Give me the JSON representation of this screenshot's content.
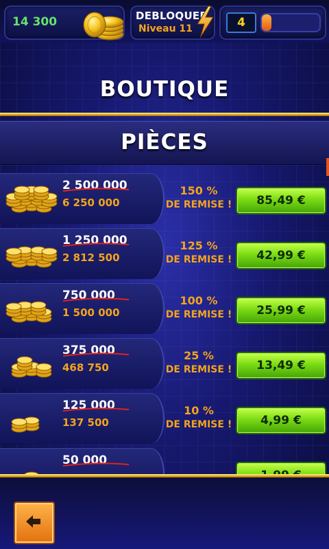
{
  "header": {
    "coins": "14 300",
    "unlock_title": "DEBLOQUER",
    "unlock_level": "Niveau 11",
    "player_level": "4",
    "xp_progress_percent": 17
  },
  "shop": {
    "title": "BOUTIQUE",
    "section": "PIÈCES"
  },
  "offers": [
    {
      "old": "2 500 000",
      "new": "6 250 000",
      "discount": "150 %",
      "discount_label": "DE REMISE !",
      "price": "85,49 €",
      "coins_icon": "coin-pile-huge"
    },
    {
      "old": "1 250 000",
      "new": "2 812 500",
      "discount": "125 %",
      "discount_label": "DE REMISE !",
      "price": "42,99 €",
      "coins_icon": "coin-pile-large"
    },
    {
      "old": "750 000",
      "new": "1 500 000",
      "discount": "100 %",
      "discount_label": "DE REMISE !",
      "price": "25,99 €",
      "coins_icon": "coin-pile-medium"
    },
    {
      "old": "375 000",
      "new": "468 750",
      "discount": "25 %",
      "discount_label": "DE REMISE !",
      "price": "13,49 €",
      "coins_icon": "coin-stack-small"
    },
    {
      "old": "125 000",
      "new": "137 500",
      "discount": "10 %",
      "discount_label": "DE REMISE !",
      "price": "4,99 €",
      "coins_icon": "coin-stack-tiny"
    },
    {
      "old": "50 000",
      "new": "",
      "discount": "",
      "discount_label": "",
      "price": "1,99 €",
      "coins_icon": "coin-single"
    }
  ],
  "colors": {
    "accent_gold": "#f3a41c",
    "buy_green": "#7bdc14",
    "coin_counter": "#63e36a",
    "background": "#16186e"
  }
}
